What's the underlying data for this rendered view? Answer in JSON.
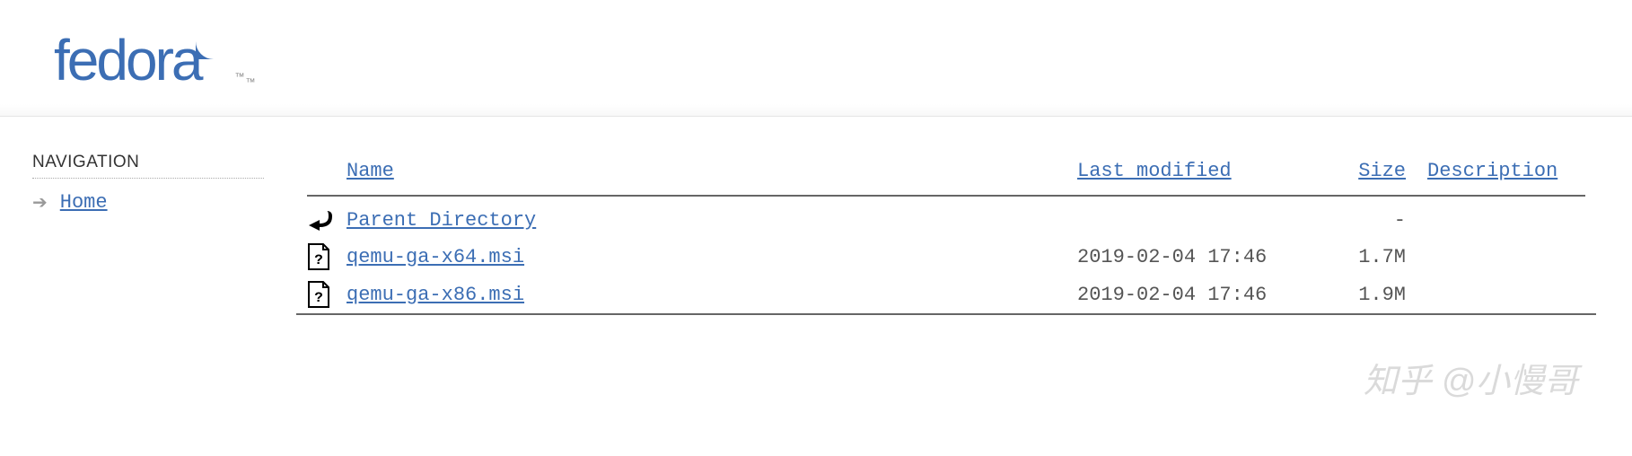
{
  "logo": {
    "text": "fedora",
    "tm": "™"
  },
  "sidebar": {
    "heading": "NAVIGATION",
    "home_label": "Home"
  },
  "listing": {
    "headers": {
      "name": "Name",
      "modified": "Last modified",
      "size": "Size",
      "description": "Description"
    },
    "parent": {
      "label": "Parent Directory",
      "size": "-"
    },
    "rows": [
      {
        "name": "qemu-ga-x64.msi",
        "modified": "2019-02-04 17:46",
        "size": "1.7M",
        "description": ""
      },
      {
        "name": "qemu-ga-x86.msi",
        "modified": "2019-02-04 17:46",
        "size": "1.9M",
        "description": ""
      }
    ]
  },
  "watermark": "知乎 @小慢哥"
}
